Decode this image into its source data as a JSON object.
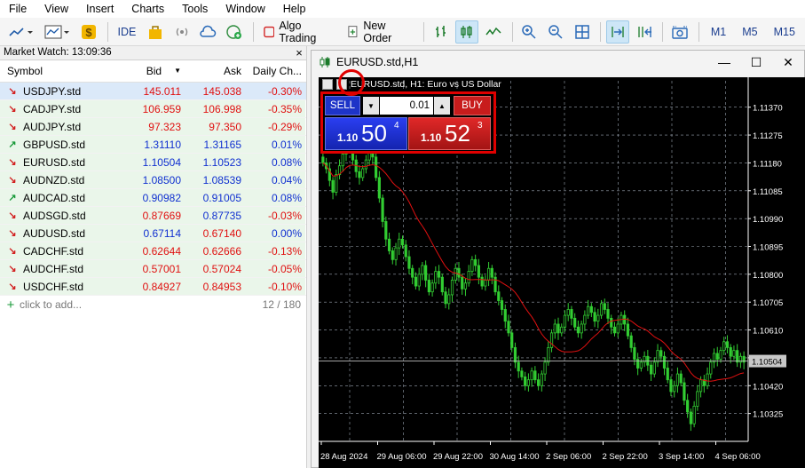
{
  "menu": [
    "File",
    "View",
    "Insert",
    "Charts",
    "Tools",
    "Window",
    "Help"
  ],
  "toolbar": {
    "ide_label": "IDE",
    "algo_label": "Algo Trading",
    "new_order_label": "New Order",
    "timeframes": [
      "M1",
      "M5",
      "M15"
    ]
  },
  "market_watch": {
    "title": "Market Watch: 13:09:36",
    "columns": [
      "Symbol",
      "Bid",
      "Ask",
      "Daily Ch..."
    ],
    "rows": [
      {
        "symbol": "USDJPY.std",
        "bid": "145.011",
        "ask": "145.038",
        "change": "-0.30%",
        "dir": "down",
        "bid_color": "red",
        "ask_color": "red",
        "change_color": "red",
        "selected": true
      },
      {
        "symbol": "CADJPY.std",
        "bid": "106.959",
        "ask": "106.998",
        "change": "-0.35%",
        "dir": "down",
        "bid_color": "red",
        "ask_color": "red",
        "change_color": "red"
      },
      {
        "symbol": "AUDJPY.std",
        "bid": "97.323",
        "ask": "97.350",
        "change": "-0.29%",
        "dir": "down",
        "bid_color": "red",
        "ask_color": "red",
        "change_color": "red"
      },
      {
        "symbol": "GBPUSD.std",
        "bid": "1.31110",
        "ask": "1.31165",
        "change": "0.01%",
        "dir": "up",
        "bid_color": "blue",
        "ask_color": "blue",
        "change_color": "blue"
      },
      {
        "symbol": "EURUSD.std",
        "bid": "1.10504",
        "ask": "1.10523",
        "change": "0.08%",
        "dir": "down",
        "bid_color": "blue",
        "ask_color": "blue",
        "change_color": "blue"
      },
      {
        "symbol": "AUDNZD.std",
        "bid": "1.08500",
        "ask": "1.08539",
        "change": "0.04%",
        "dir": "down",
        "bid_color": "blue",
        "ask_color": "blue",
        "change_color": "blue"
      },
      {
        "symbol": "AUDCAD.std",
        "bid": "0.90982",
        "ask": "0.91005",
        "change": "0.08%",
        "dir": "up",
        "bid_color": "blue",
        "ask_color": "blue",
        "change_color": "blue"
      },
      {
        "symbol": "AUDSGD.std",
        "bid": "0.87669",
        "ask": "0.87735",
        "change": "-0.03%",
        "dir": "down",
        "bid_color": "red",
        "ask_color": "blue",
        "change_color": "red"
      },
      {
        "symbol": "AUDUSD.std",
        "bid": "0.67114",
        "ask": "0.67140",
        "change": "0.00%",
        "dir": "down",
        "bid_color": "blue",
        "ask_color": "red",
        "change_color": "blue"
      },
      {
        "symbol": "CADCHF.std",
        "bid": "0.62644",
        "ask": "0.62666",
        "change": "-0.13%",
        "dir": "down",
        "bid_color": "red",
        "ask_color": "red",
        "change_color": "red"
      },
      {
        "symbol": "AUDCHF.std",
        "bid": "0.57001",
        "ask": "0.57024",
        "change": "-0.05%",
        "dir": "down",
        "bid_color": "red",
        "ask_color": "red",
        "change_color": "red"
      },
      {
        "symbol": "USDCHF.std",
        "bid": "0.84927",
        "ask": "0.84953",
        "change": "-0.10%",
        "dir": "down",
        "bid_color": "red",
        "ask_color": "red",
        "change_color": "red"
      }
    ],
    "add_label": "click to add...",
    "count": "12 / 180"
  },
  "chart_window": {
    "title": "EURUSD.std,H1",
    "header": "EURUSD.std, H1:  Euro vs US Dollar",
    "trade_panel": {
      "sell_label": "SELL",
      "buy_label": "BUY",
      "volume": "0.01",
      "sell_price_small": "1.10",
      "sell_price_big": "50",
      "sell_price_sup": "4",
      "buy_price_small": "1.10",
      "buy_price_big": "52",
      "buy_price_sup": "3"
    },
    "current_price": "1.10504"
  },
  "chart_data": {
    "type": "candlestick",
    "symbol": "EURUSD.std",
    "timeframe": "H1",
    "y_ticks": [
      "1.11370",
      "1.11275",
      "1.11180",
      "1.11085",
      "1.10990",
      "1.10895",
      "1.10800",
      "1.10705",
      "1.10610",
      "1.10515",
      "1.10420",
      "1.10325"
    ],
    "ylim": [
      1.1023,
      1.1146
    ],
    "x_ticks": [
      "28 Aug 2024",
      "29 Aug 06:00",
      "29 Aug 22:00",
      "30 Aug 14:00",
      "2 Sep 06:00",
      "2 Sep 22:00",
      "3 Sep 14:00",
      "4 Sep 06:00"
    ],
    "current_price": 1.10504,
    "closes": [
      1.1118,
      1.1116,
      1.1112,
      1.1108,
      1.1114,
      1.1117,
      1.1121,
      1.1125,
      1.1123,
      1.1119,
      1.1115,
      1.1113,
      1.1116,
      1.1119,
      1.1122,
      1.112,
      1.1113,
      1.1106,
      1.1098,
      1.1092,
      1.1088,
      1.1085,
      1.1089,
      1.1092,
      1.109,
      1.1086,
      1.1082,
      1.1079,
      1.1076,
      1.108,
      1.1083,
      1.1078,
      1.1074,
      1.1077,
      1.1081,
      1.1079,
      1.1074,
      1.107,
      1.1073,
      1.1078,
      1.1082,
      1.1079,
      1.1075,
      1.1077,
      1.1081,
      1.1085,
      1.1083,
      1.1079,
      1.1076,
      1.1078,
      1.1082,
      1.1079,
      1.1074,
      1.1071,
      1.1068,
      1.1064,
      1.106,
      1.1055,
      1.105,
      1.1047,
      1.1045,
      1.1042,
      1.1044,
      1.1047,
      1.1044,
      1.1042,
      1.1046,
      1.105,
      1.1055,
      1.106,
      1.1063,
      1.106,
      1.1062,
      1.1066,
      1.1068,
      1.1065,
      1.1062,
      1.106,
      1.1063,
      1.1066,
      1.1069,
      1.1067,
      1.1064,
      1.1066,
      1.107,
      1.1068,
      1.1065,
      1.1062,
      1.106,
      1.1063,
      1.1066,
      1.1063,
      1.1059,
      1.1055,
      1.1051,
      1.1048,
      1.105,
      1.1052,
      1.1049,
      1.1046,
      1.105,
      1.1054,
      1.1052,
      1.1048,
      1.1044,
      1.104,
      1.1042,
      1.1046,
      1.1043,
      1.1037,
      1.1033,
      1.1029,
      1.1035,
      1.104,
      1.1044,
      1.1042,
      1.1046,
      1.105,
      1.1053,
      1.1051,
      1.1054,
      1.1057,
      1.1055,
      1.1052,
      1.1054,
      1.105,
      1.1052,
      1.105
    ]
  },
  "colors": {
    "chart_bg": "#000000",
    "candle": "#32cd32",
    "ma_line": "#e01010",
    "sell": "#1e34c8",
    "buy": "#c81c1c",
    "highlight": "#e00000"
  }
}
